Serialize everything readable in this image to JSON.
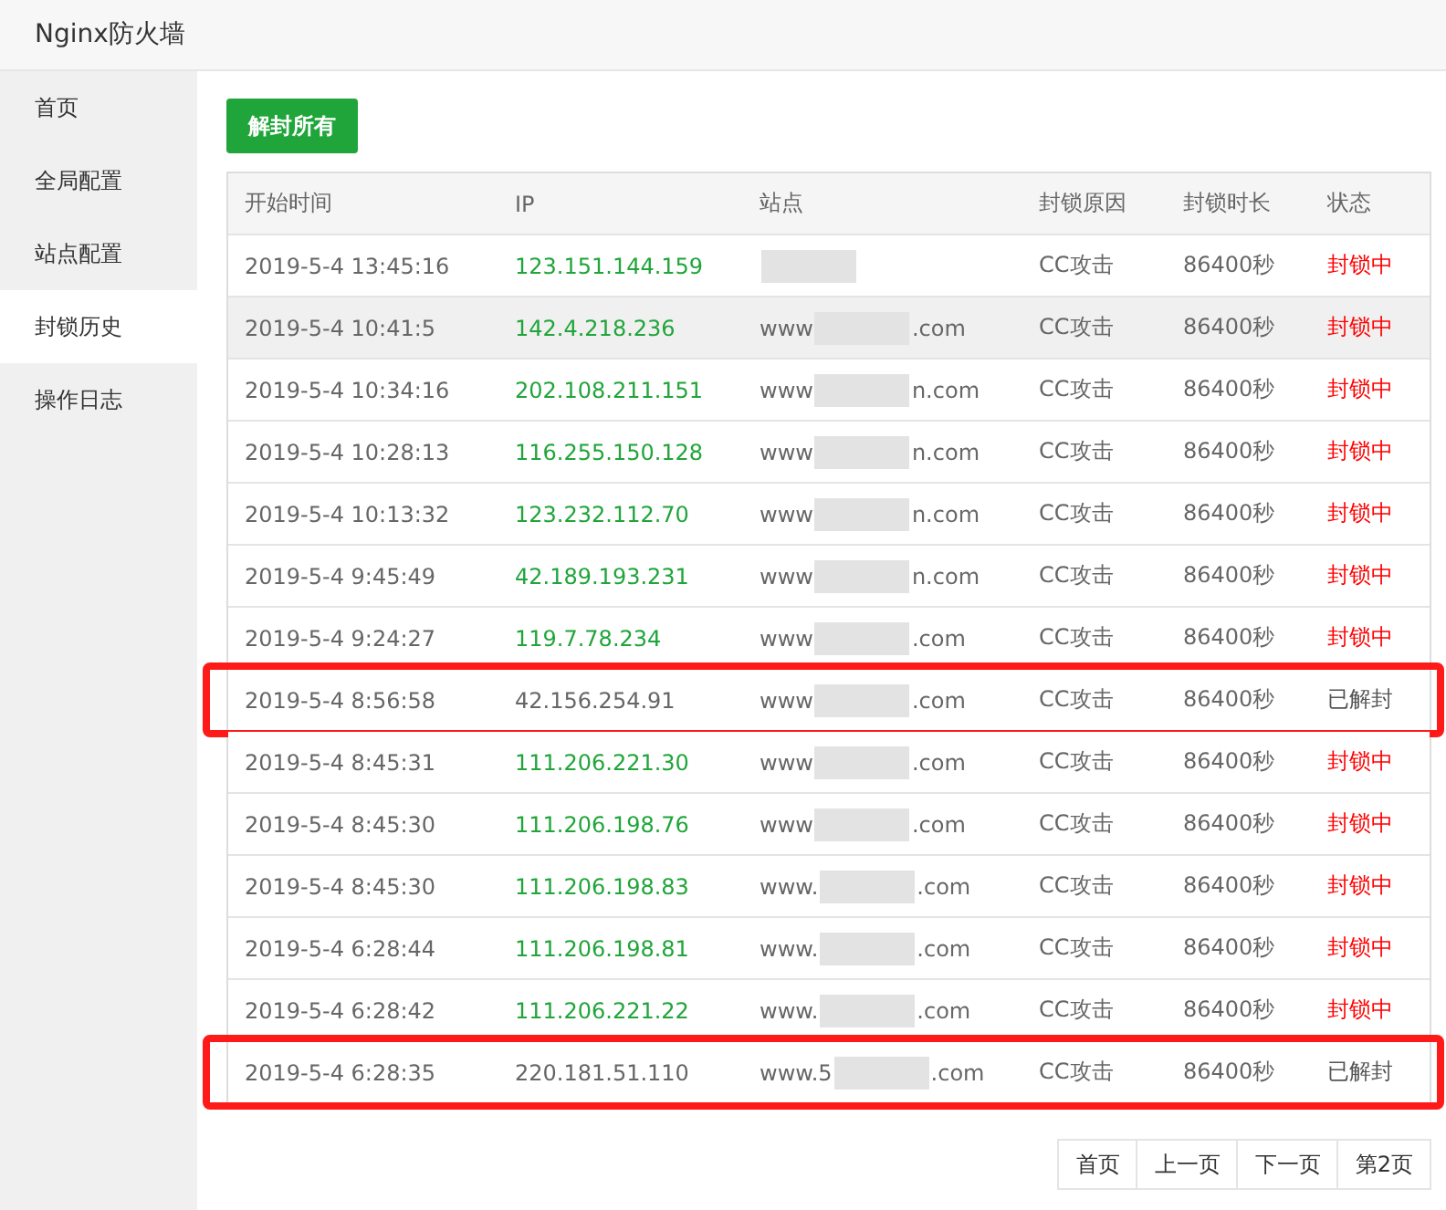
{
  "window": {
    "title": "Nginx防火墙"
  },
  "sidebar": {
    "items": [
      {
        "label": "首页",
        "selected": false
      },
      {
        "label": "全局配置",
        "selected": false
      },
      {
        "label": "站点配置",
        "selected": false
      },
      {
        "label": "封锁历史",
        "selected": true
      },
      {
        "label": "操作日志",
        "selected": false
      }
    ]
  },
  "unblock_all_button": "解封所有",
  "table": {
    "columns": [
      "开始时间",
      "IP",
      "站点",
      "封锁原因",
      "封锁时长",
      "状态"
    ],
    "rows": [
      {
        "time": "2019-5-4 13:45:16",
        "ip": "123.151.144.159",
        "site_end": "",
        "reason": "CC攻击",
        "duration": "86400秒",
        "status": "封锁中",
        "kind": "blocked",
        "boxed": false,
        "shaded": false
      },
      {
        "time": "2019-5-4 10:41:5",
        "ip": "142.4.218.236",
        "site_start": "www",
        "site_end": ".com",
        "reason": "CC攻击",
        "duration": "86400秒",
        "status": "封锁中",
        "kind": "blocked",
        "boxed": false,
        "shaded": true
      },
      {
        "time": "2019-5-4 10:34:16",
        "ip": "202.108.211.151",
        "site_start": "www",
        "site_end": "n.com",
        "reason": "CC攻击",
        "duration": "86400秒",
        "status": "封锁中",
        "kind": "blocked",
        "boxed": false,
        "shaded": false
      },
      {
        "time": "2019-5-4 10:28:13",
        "ip": "116.255.150.128",
        "site_start": "www",
        "site_end": "n.com",
        "reason": "CC攻击",
        "duration": "86400秒",
        "status": "封锁中",
        "kind": "blocked",
        "boxed": false,
        "shaded": false
      },
      {
        "time": "2019-5-4 10:13:32",
        "ip": "123.232.112.70",
        "site_start": "www",
        "site_end": "n.com",
        "reason": "CC攻击",
        "duration": "86400秒",
        "status": "封锁中",
        "kind": "blocked",
        "boxed": false,
        "shaded": false
      },
      {
        "time": "2019-5-4 9:45:49",
        "ip": "42.189.193.231",
        "site_start": "www",
        "site_end": "n.com",
        "reason": "CC攻击",
        "duration": "86400秒",
        "status": "封锁中",
        "kind": "blocked",
        "boxed": false,
        "shaded": false
      },
      {
        "time": "2019-5-4 9:24:27",
        "ip": "119.7.78.234",
        "site_start": "www",
        "site_end": ".com",
        "reason": "CC攻击",
        "duration": "86400秒",
        "status": "封锁中",
        "kind": "blocked",
        "boxed": false,
        "shaded": false
      },
      {
        "time": "2019-5-4 8:56:58",
        "ip": "42.156.254.91",
        "site_start": "www",
        "site_end": ".com",
        "reason": "CC攻击",
        "duration": "86400秒",
        "status": "已解封",
        "kind": "unblocked",
        "boxed": true,
        "shaded": false
      },
      {
        "time": "2019-5-4 8:45:31",
        "ip": "111.206.221.30",
        "site_start": "www",
        "site_end": ".com",
        "reason": "CC攻击",
        "duration": "86400秒",
        "status": "封锁中",
        "kind": "blocked",
        "boxed": false,
        "shaded": false
      },
      {
        "time": "2019-5-4 8:45:30",
        "ip": "111.206.198.76",
        "site_start": "www",
        "site_end": ".com",
        "reason": "CC攻击",
        "duration": "86400秒",
        "status": "封锁中",
        "kind": "blocked",
        "boxed": false,
        "shaded": false
      },
      {
        "time": "2019-5-4 8:45:30",
        "ip": "111.206.198.83",
        "site_start": "www.",
        "site_end": ".com",
        "reason": "CC攻击",
        "duration": "86400秒",
        "status": "封锁中",
        "kind": "blocked",
        "boxed": false,
        "shaded": false
      },
      {
        "time": "2019-5-4 6:28:44",
        "ip": "111.206.198.81",
        "site_start": "www.",
        "site_end": ".com",
        "reason": "CC攻击",
        "duration": "86400秒",
        "status": "封锁中",
        "kind": "blocked",
        "boxed": false,
        "shaded": false
      },
      {
        "time": "2019-5-4 6:28:42",
        "ip": "111.206.221.22",
        "site_start": "www.",
        "site_end": ".com",
        "reason": "CC攻击",
        "duration": "86400秒",
        "status": "封锁中",
        "kind": "blocked",
        "boxed": false,
        "shaded": false
      },
      {
        "time": "2019-5-4 6:28:35",
        "ip": "220.181.51.110",
        "site_start": "www.5",
        "site_end": ".com",
        "reason": "CC攻击",
        "duration": "86400秒",
        "status": "已解封",
        "kind": "unblocked",
        "boxed": true,
        "shaded": false
      }
    ]
  },
  "pagination": [
    "首页",
    "上一页",
    "下一页",
    "第2页"
  ]
}
